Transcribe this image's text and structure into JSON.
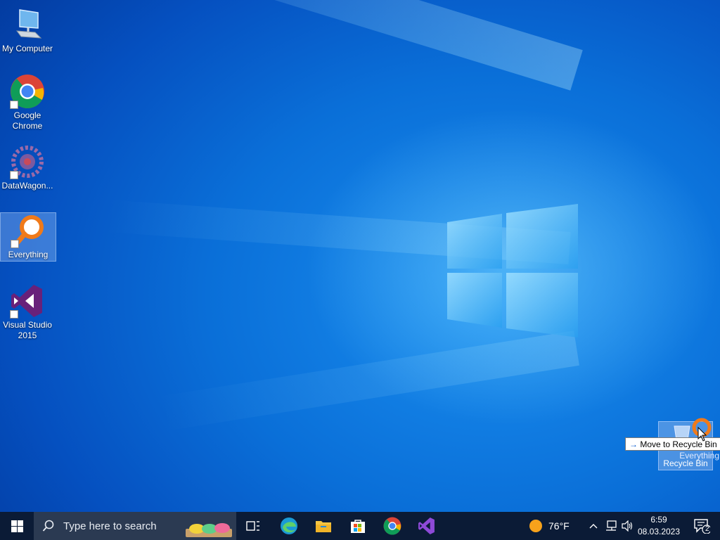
{
  "desktop": {
    "icons": [
      {
        "label": "My Computer"
      },
      {
        "label": "Google Chrome"
      },
      {
        "label": "DataWagon..."
      },
      {
        "label": "Everything"
      },
      {
        "label": "Visual Studio 2015"
      }
    ],
    "drag": {
      "ghost_label": "Recycle Bin",
      "dragged_label": "Everything",
      "tooltip_arrow": "→",
      "tooltip_text": "Move to Recycle Bin"
    }
  },
  "taskbar": {
    "search_placeholder": "Type here to search",
    "pinned": [
      "task-view",
      "edge",
      "file-explorer",
      "microsoft-store",
      "google-chrome",
      "visual-studio"
    ],
    "weather": {
      "temperature": "76°F",
      "icon": "sun-icon"
    },
    "clock": {
      "time": "6:59",
      "date": "08.03.2023"
    },
    "notifications": {
      "count": "2"
    }
  },
  "colors": {
    "taskbar": "#0b1b36",
    "search_box": "#2b3a52",
    "desktop_accent": "#0a6fd8"
  }
}
